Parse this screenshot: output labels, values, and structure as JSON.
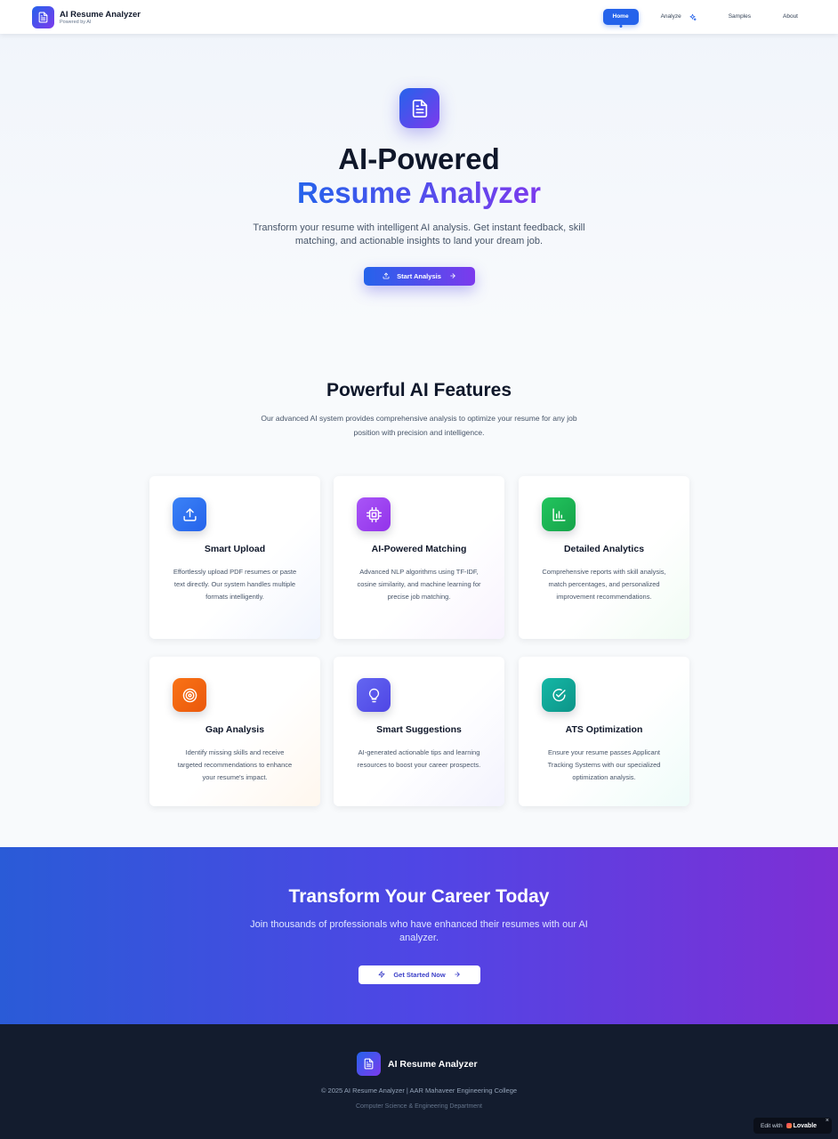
{
  "colors": {
    "primary": "#2563eb",
    "secondary": "#7c3aed",
    "dark": "#0f172a",
    "footer_bg": "#131c2e"
  },
  "nav": {
    "brand_title": "AI Resume Analyzer",
    "brand_subtitle": "Powered by AI",
    "brand_icon": "document-icon",
    "links": [
      {
        "label": "Home",
        "active": true
      },
      {
        "label": "Analyze",
        "active": false,
        "icon": "sparkle-icon"
      },
      {
        "label": "Samples",
        "active": false
      },
      {
        "label": "About",
        "active": false
      }
    ]
  },
  "hero": {
    "icon": "document-icon",
    "title_line1": "AI-Powered",
    "title_line2": "Resume Analyzer",
    "description": "Transform your resume with intelligent AI analysis. Get instant feedback, skill matching, and actionable insights to land your dream job.",
    "button_label": "Start Analysis"
  },
  "features": {
    "title": "Powerful AI Features",
    "description": "Our advanced AI system provides comprehensive analysis to optimize your resume for any job position with precision and intelligence.",
    "cards": [
      {
        "title": "Smart Upload",
        "description": "Effortlessly upload PDF resumes or paste text directly. Our system handles multiple formats intelligently.",
        "icon": "upload-icon",
        "color": "#3b82f6"
      },
      {
        "title": "AI-Powered Matching",
        "description": "Advanced NLP algorithms using TF-IDF, cosine similarity, and machine learning for precise job matching.",
        "icon": "cpu-icon",
        "color": "#a855f7"
      },
      {
        "title": "Detailed Analytics",
        "description": "Comprehensive reports with skill analysis, match percentages, and personalized improvement recommendations.",
        "icon": "bar-chart-icon",
        "color": "#22c55e"
      },
      {
        "title": "Gap Analysis",
        "description": "Identify missing skills and receive targeted recommendations to enhance your resume's impact.",
        "icon": "target-icon",
        "color": "#f97316"
      },
      {
        "title": "Smart Suggestions",
        "description": "AI-generated actionable tips and learning resources to boost your career prospects.",
        "icon": "lightbulb-icon",
        "color": "#6366f1"
      },
      {
        "title": "ATS Optimization",
        "description": "Ensure your resume passes Applicant Tracking Systems with our specialized optimization analysis.",
        "icon": "check-circle-icon",
        "color": "#14b8a6"
      }
    ]
  },
  "cta": {
    "title": "Transform Your Career Today",
    "description": "Join thousands of professionals who have enhanced their resumes with our AI analyzer.",
    "button_label": "Get Started Now"
  },
  "footer": {
    "brand_title": "AI Resume Analyzer",
    "copyright": "© 2025 AI Resume Analyzer | AAR Mahaveer Engineering College",
    "department": "Computer Science & Engineering Department"
  },
  "badge": {
    "edit_label": "Edit with",
    "brand": "Lovable",
    "close": "×"
  }
}
